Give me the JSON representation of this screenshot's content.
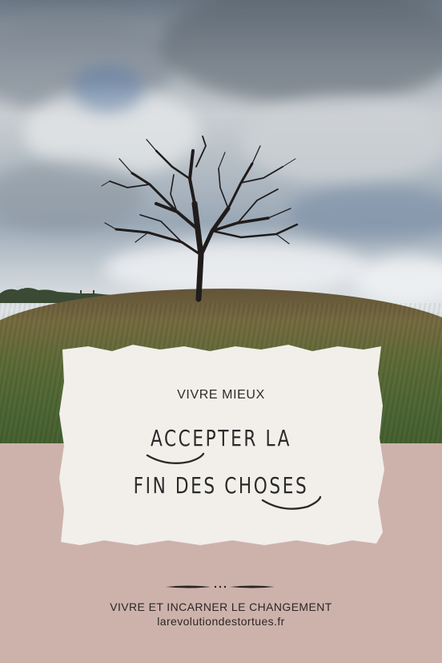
{
  "card": {
    "eyebrow": "VIVRE MIEUX",
    "title_line_1": "ACCEPTER LA",
    "title_line_2": "FIN DES CHOSES"
  },
  "footer": {
    "tagline": "VIVRE ET INCARNER LE CHANGEMENT",
    "website": "larevolutiondestortues.fr"
  },
  "colors": {
    "background_panel": "#cdb2ac",
    "card_paper": "#f2efeb",
    "text_dark": "#2a2a2a"
  },
  "icons": {
    "divider": "ornamental-divider-icon"
  }
}
